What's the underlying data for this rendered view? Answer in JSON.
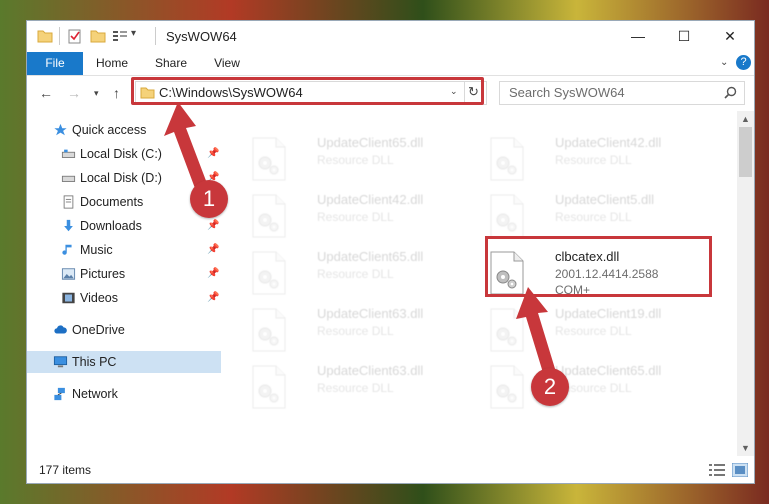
{
  "window": {
    "title": "SysWOW64",
    "controls": {
      "minimize": "—",
      "maximize": "☐",
      "close": "✕"
    }
  },
  "ribbon": {
    "tabs": [
      {
        "label": "File",
        "active": true
      },
      {
        "label": "Home"
      },
      {
        "label": "Share"
      },
      {
        "label": "View"
      }
    ],
    "help_icon": "help-icon"
  },
  "navigation": {
    "address": "C:\\Windows\\SysWOW64",
    "search_placeholder": "Search SysWOW64"
  },
  "sidebar": {
    "items": [
      {
        "label": "Quick access",
        "icon": "star-icon"
      },
      {
        "label": "Local Disk (C:)",
        "icon": "drive-icon",
        "pinned": true
      },
      {
        "label": "Local Disk (D:)",
        "icon": "drive-icon",
        "pinned": true
      },
      {
        "label": "Documents",
        "icon": "documents-icon",
        "pinned": true
      },
      {
        "label": "Downloads",
        "icon": "download-icon",
        "pinned": true
      },
      {
        "label": "Music",
        "icon": "music-icon",
        "pinned": true
      },
      {
        "label": "Pictures",
        "icon": "pictures-icon",
        "pinned": true
      },
      {
        "label": "Videos",
        "icon": "videos-icon",
        "pinned": true
      },
      {
        "label": "OneDrive",
        "icon": "cloud-icon"
      },
      {
        "label": "This PC",
        "icon": "computer-icon",
        "selected": true
      },
      {
        "label": "Network",
        "icon": "network-icon"
      }
    ]
  },
  "files": [
    {
      "name": "UpdateClient65.dll",
      "type": "Resource DLL"
    },
    {
      "name": "UpdateClient42.dll",
      "type": "Resource DLL"
    },
    {
      "name": "UpdateClient42.dll",
      "type": "Resource DLL"
    },
    {
      "name": "UpdateClient5.dll",
      "type": "Resource DLL"
    },
    {
      "name": "UpdateClient65.dll",
      "type": "Resource DLL"
    },
    {
      "name": "clbcatex.dll",
      "version": "2001.12.4414.2588",
      "type": "COM+",
      "highlighted": true
    },
    {
      "name": "UpdateClient63.dll",
      "type": "Resource DLL"
    },
    {
      "name": "UpdateClient19.dll",
      "type": "Resource DLL"
    },
    {
      "name": "UpdateClient63.dll",
      "type": "Resource DLL"
    },
    {
      "name": "UpdateClient65.dll",
      "type": "Resource DLL"
    }
  ],
  "status": {
    "item_count": "177 items"
  },
  "callouts": [
    "1",
    "2"
  ],
  "colors": {
    "accent": "#1979ca",
    "highlight": "#c8373b",
    "selected": "#cde1f3"
  }
}
